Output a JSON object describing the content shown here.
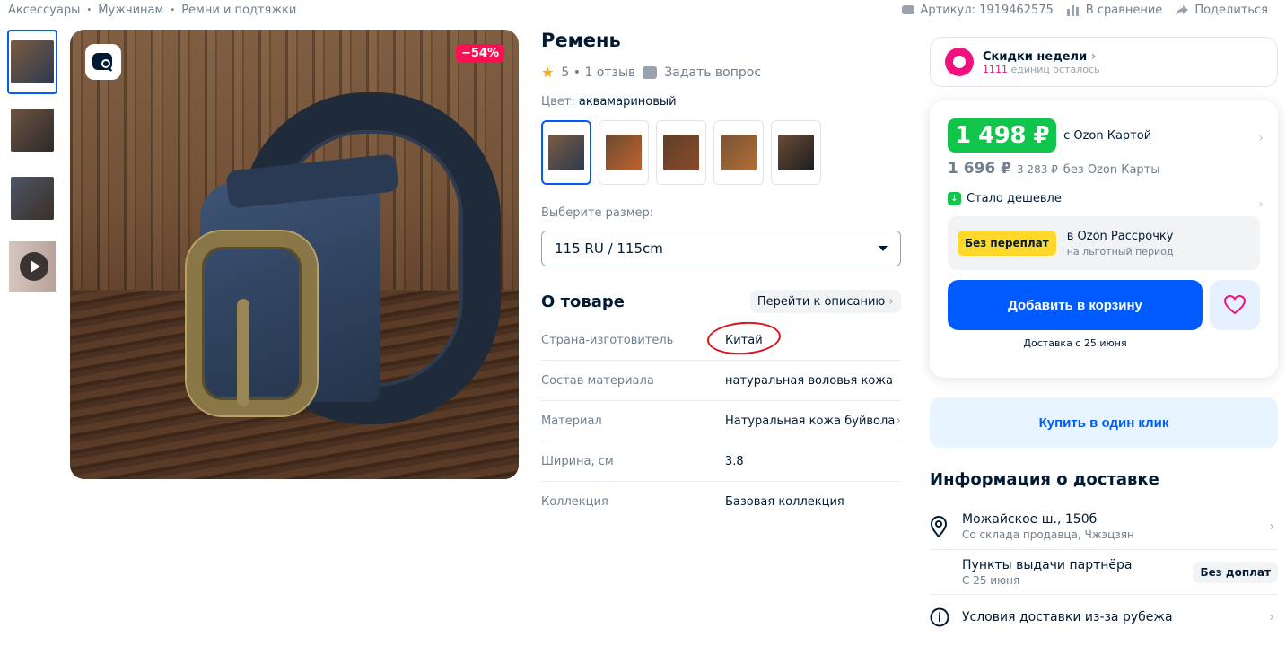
{
  "breadcrumbs": [
    "Аксессуары",
    "Мужчинам",
    "Ремни и подтяжки"
  ],
  "top_actions": {
    "sku": "Артикул: 1919462575",
    "compare": "В сравнение",
    "share": "Поделиться"
  },
  "gallery": {
    "discount_badge": "−54%",
    "thumb_colors": [
      "#5a4a3e",
      "#6e5442",
      "#4e5567"
    ]
  },
  "product": {
    "title": "Ремень",
    "rating": "5",
    "reviews": "1 отзыв",
    "ask": "Задать вопрос",
    "color_label": "Цвет:",
    "color_value": "аквамариновый",
    "size_label": "Выберите размер:",
    "size_value": "115 RU / 115cm"
  },
  "about": {
    "title": "О товаре",
    "go_to_description": "Перейти к описанию",
    "specs": [
      {
        "key": "Страна-изготовитель",
        "value": "Китай"
      },
      {
        "key": "Состав материала",
        "value": "натуральная воловья кожа"
      },
      {
        "key": "Материал",
        "value": "Натуральная кожа буйвола"
      },
      {
        "key": "Ширина, см",
        "value": "3.8"
      },
      {
        "key": "Коллекция",
        "value": "Базовая коллекция"
      }
    ]
  },
  "weekly": {
    "title": "Скидки недели",
    "count": "1111",
    "remaining": "единиц осталось"
  },
  "price": {
    "card_price": "1 498 ₽",
    "card_caption": "с Ozon Картой",
    "regular_price": "1 696 ₽",
    "old_price": "3 283 ₽",
    "regular_caption": "без Ozon Карты",
    "cheaper": "Стало дешевле",
    "installment_tag": "Без переплат",
    "installment_title": "в Ozon Рассрочку",
    "installment_sub": "на льготный период",
    "add_to_cart": "Добавить в корзину",
    "delivery_note": "Доставка с 25 июня"
  },
  "one_click": "Купить в один клик",
  "shipping": {
    "title": "Информация о доставке",
    "address": "Можайское ш., 150б",
    "warehouse": "Со склада продавца, Чжэцзян",
    "pickup": "Пункты выдачи партнёра",
    "pickup_date": "С 25 июня",
    "pickup_badge": "Без доплат",
    "abroad": "Условия доставки из-за рубежа"
  },
  "colors": {
    "accent": "#005bff",
    "price_green": "#10c44c",
    "discount_pink": "#f91155"
  }
}
